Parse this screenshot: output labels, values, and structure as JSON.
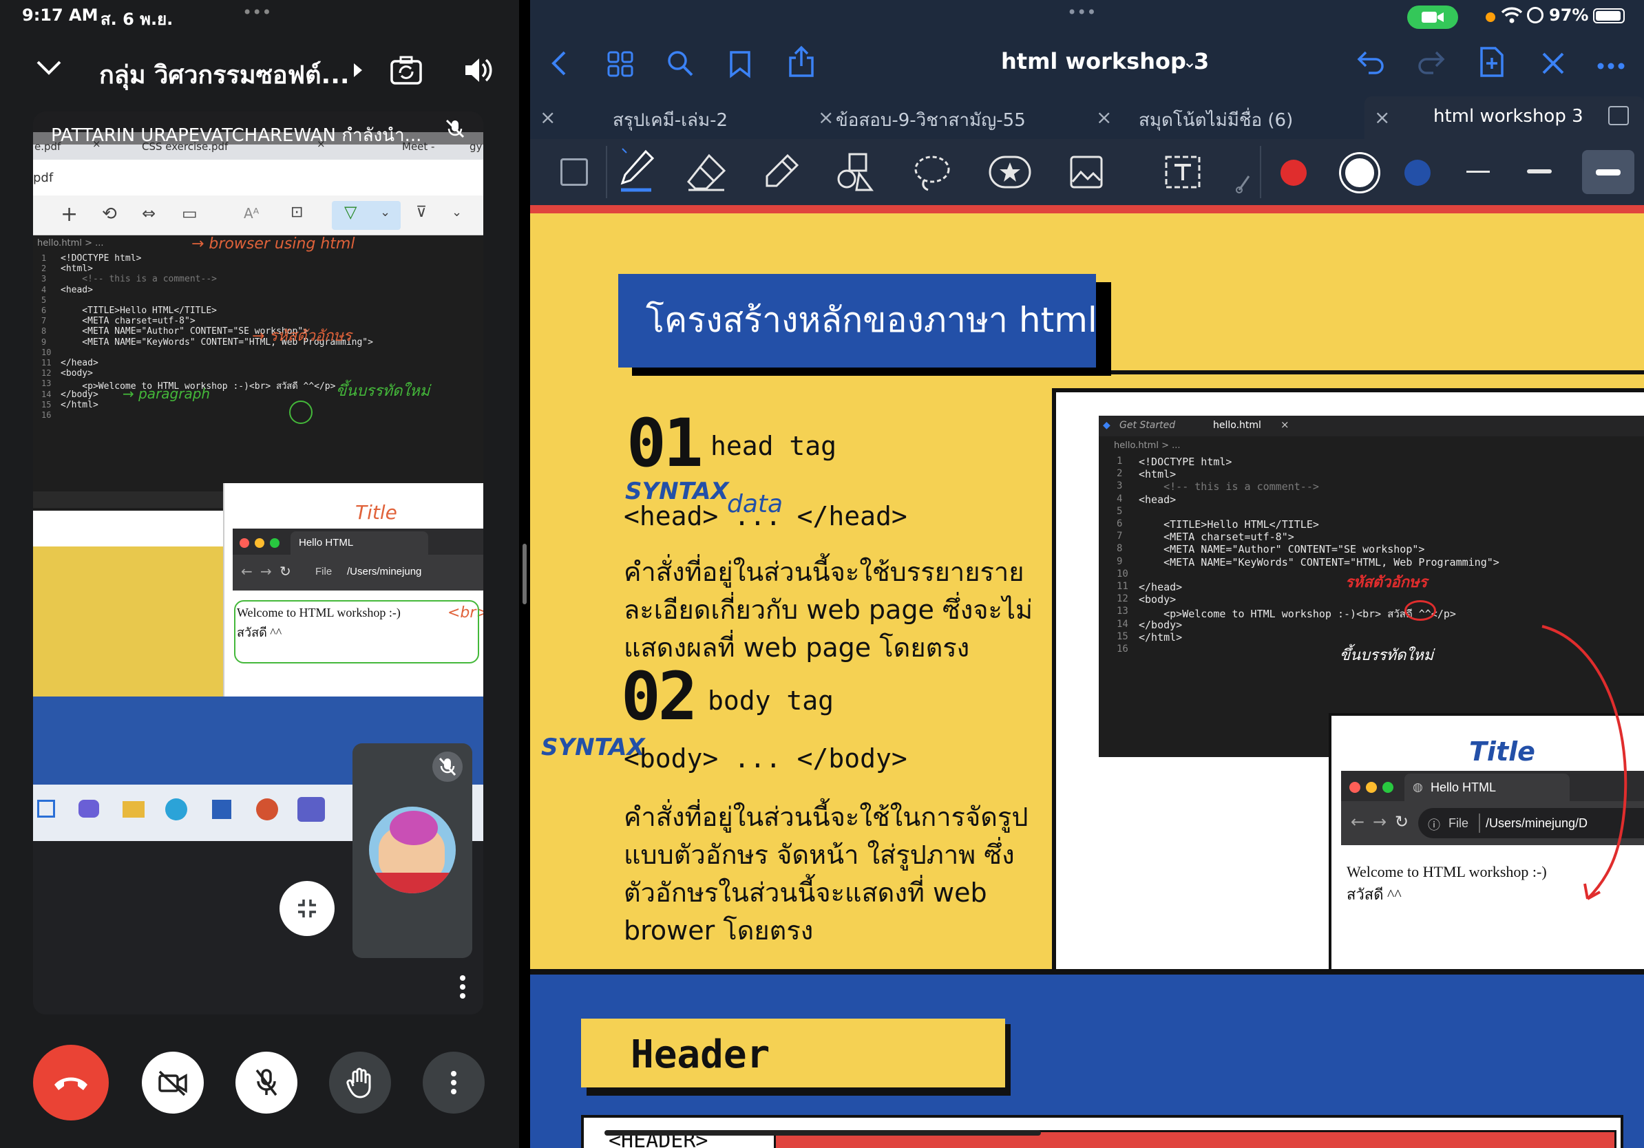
{
  "left_status": {
    "time": "9:17 AM",
    "date": "ส. 6 พ.ย.",
    "dots": "•••"
  },
  "meet": {
    "group_title": "กลุ่ม วิศวกรรมซอฟต์...",
    "presenter_banner": "PATTARIN URAPEVATCHAREWAN กำลังนำ...",
    "tab_pdf": "e.pdf",
    "tab_css": "CSS exercise.pdf",
    "tab_meet": "Meet -",
    "tab_gy": "gy",
    "path_pdf": "pdf",
    "breadcrumb": "hello.html > ...",
    "code_lines": [
      "<!DOCTYPE html>",
      "<html>",
      "    <!-- this is a comment-->",
      "<head>",
      "",
      "    <TITLE>Hello HTML</TITLE>",
      "    <META charset=utf-8\">",
      "    <META NAME=\"Author\" CONTENT=\"SE workshop\">",
      "    <META NAME=\"KeyWords\" CONTENT=\"HTML, Web Programming\">",
      "",
      "</head>",
      "<body>",
      "    <p>Welcome to HTML workshop :-)<br> สวัสดี ^^</p>",
      "</body>",
      "</html>",
      ""
    ],
    "line_numbers": [
      "1",
      "2",
      "3",
      "4",
      "5",
      "6",
      "7",
      "8",
      "9",
      "10",
      "11",
      "12",
      "13",
      "14",
      "15",
      "16"
    ],
    "annotations": {
      "browser_using_html": "→ browser using html",
      "charset_note": "→ รหัสตัวอักษร",
      "paragraph": "→ paragraph",
      "newline_note": "ขึ้นบรรทัดใหม่",
      "title_note": "Title",
      "br_note": "<br>"
    },
    "browser": {
      "tab_title": "Hello HTML",
      "file_label": "File",
      "path": "/Users/minejung",
      "body_line1": "Welcome to HTML workshop :-)",
      "body_line2": "สวัสดี ^^"
    }
  },
  "right_status": {
    "dots": "•••",
    "battery": "97%"
  },
  "goodnotes": {
    "doc_title": "html workshop 3",
    "tabs": [
      {
        "label": "สรุปเคมี-เล่ม-2"
      },
      {
        "label": "ข้อสอบ-9-วิชาสามัญ-55"
      },
      {
        "label": "สมุดโน้ตไม่มีชื่อ (6)"
      },
      {
        "label": "html workshop 3"
      }
    ],
    "colors": {
      "accent": "#e0443e",
      "blue": "#2350a8",
      "yellow": "#f5d153",
      "toolbar": "#232d3e"
    }
  },
  "slide": {
    "section_title": "โครงสร้างหลักของภาษา html",
    "item1_number": "01",
    "item1_title": "head tag",
    "item1_syntax": "<head> ... </head>",
    "item1_desc_1": "คำสั่งที่อยู่ในส่วนนี้จะใช้บรรยายราย",
    "item1_desc_2": "ละเอียดเกี่ยวกับ web page ซึ่งจะไม่",
    "item1_desc_3": "แสดงผลที่ web page โดยตรง",
    "item2_number": "02",
    "item2_title": "body tag",
    "item2_syntax": "<body> ... </body>",
    "item2_desc_1": "คำสั่งที่อยู่ในส่วนนี้จะใช้ในการจัดรูป",
    "item2_desc_2": "แบบตัวอักษร จัดหน้า ใส่รูปภาพ ซึ่ง",
    "item2_desc_3": "ตัวอักษรในส่วนนี้จะแสดงที่ web",
    "item2_desc_4": "brower โดยตรง",
    "hand_syntax": "SYNTAX",
    "hand_data": "data",
    "hand_syntax2": "SYNTAX",
    "hand_title": "Title",
    "hand_charset": "รหัสตัวอักษร",
    "hand_newline": "ขึ้นบรรทัดใหม่",
    "editor_tab1": "Get Started",
    "editor_tab2": "hello.html",
    "editor_breadcrumb": "hello.html > ...",
    "browser_tab": "Hello HTML",
    "browser_file": "File",
    "browser_path": "/Users/minejung/D",
    "browser_line1": "Welcome to HTML workshop :-)",
    "browser_line2": "สวัสดี ^^",
    "header_box": "Header",
    "header_tag": "<HEADER>"
  }
}
